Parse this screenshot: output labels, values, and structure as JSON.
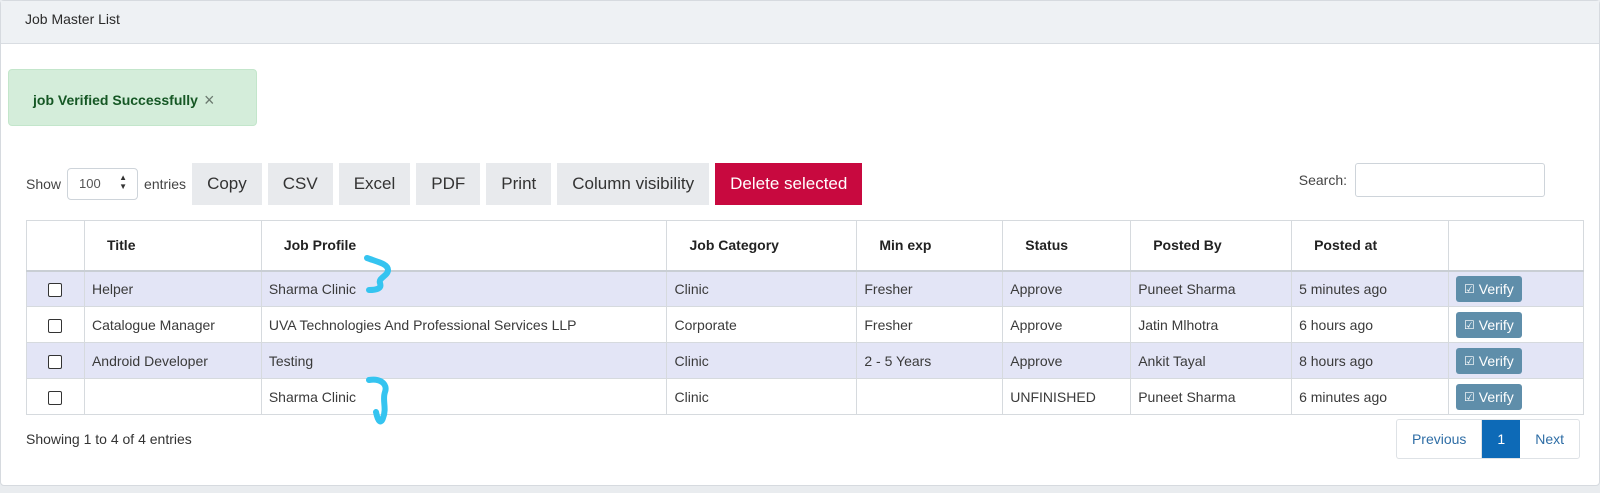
{
  "header": {
    "title": "Job Master List"
  },
  "alert": {
    "message": "job Verified Successfully",
    "close_icon": "×"
  },
  "toolbar": {
    "show_label": "Show",
    "entries_label": "entries",
    "length_value": "100",
    "buttons": [
      "Copy",
      "CSV",
      "Excel",
      "PDF",
      "Print",
      "Column visibility"
    ],
    "delete_label": "Delete selected",
    "search_label": "Search:",
    "search_value": ""
  },
  "table": {
    "columns": [
      "",
      "Title",
      "Job Profile",
      "Job Category",
      "Min exp",
      "Status",
      "Posted By",
      "Posted at",
      ""
    ],
    "rows": [
      {
        "title": "Helper",
        "profile": "Sharma Clinic",
        "category": "Clinic",
        "min_exp": "Fresher",
        "status": "Approve",
        "posted_by": "Puneet Sharma",
        "posted_at": "5 minutes ago",
        "action": "Verify"
      },
      {
        "title": "Catalogue Manager",
        "profile": "UVA Technologies And Professional Services LLP",
        "category": "Corporate",
        "min_exp": "Fresher",
        "status": "Approve",
        "posted_by": "Jatin Mlhotra",
        "posted_at": "6 hours ago",
        "action": "Verify"
      },
      {
        "title": "Android Developer",
        "profile": "Testing",
        "category": "Clinic",
        "min_exp": "2 - 5 Years",
        "status": "Approve",
        "posted_by": "Ankit Tayal",
        "posted_at": "8 hours ago",
        "action": "Verify"
      },
      {
        "title": "",
        "profile": "Sharma Clinic",
        "category": "Clinic",
        "min_exp": "",
        "status": "UNFINISHED",
        "posted_by": "Puneet Sharma",
        "posted_at": "6 minutes ago",
        "action": "Verify"
      }
    ]
  },
  "footer": {
    "info": "Showing 1 to 4 of 4 entries",
    "previous": "Previous",
    "current_page": "1",
    "next": "Next"
  },
  "colors": {
    "danger": "#c8093f",
    "verify": "#5f8eaa",
    "page_active": "#0d6ab7",
    "alert_bg": "#d4edda",
    "annotation": "#35c4f0"
  }
}
